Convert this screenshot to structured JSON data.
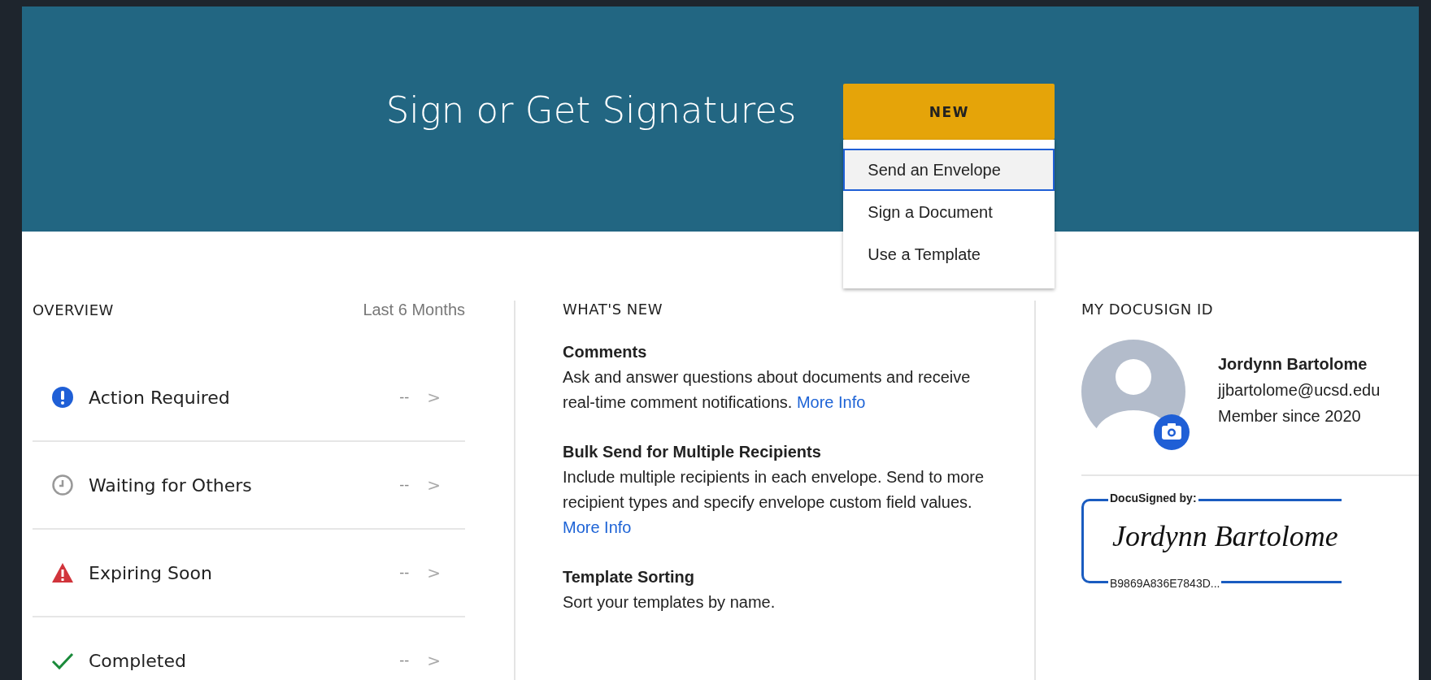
{
  "banner": {
    "title": "Sign or Get Signatures",
    "new_button": "NEW",
    "menu": [
      {
        "label": "Send an Envelope",
        "selected": true
      },
      {
        "label": "Sign a Document",
        "selected": false
      },
      {
        "label": "Use a Template",
        "selected": false
      }
    ]
  },
  "overview": {
    "title": "OVERVIEW",
    "period": "Last 6 Months",
    "rows": [
      {
        "kind": "action",
        "label": "Action Required",
        "count": "--",
        "arrow": ">"
      },
      {
        "kind": "waiting",
        "label": "Waiting for Others",
        "count": "--",
        "arrow": ">"
      },
      {
        "kind": "expiring",
        "label": "Expiring Soon",
        "count": "--",
        "arrow": ">"
      },
      {
        "kind": "completed",
        "label": "Completed",
        "count": "--",
        "arrow": ">"
      }
    ]
  },
  "whats_new": {
    "title": "WHAT'S NEW",
    "items": [
      {
        "title": "Comments",
        "text": "Ask and answer questions about documents and receive real-time comment notifications.",
        "link": "More Info"
      },
      {
        "title": "Bulk Send for Multiple Recipients",
        "text": "Include multiple recipients in each envelope. Send to more recipient types and specify envelope custom field values.",
        "link": "More Info"
      },
      {
        "title": "Template Sorting",
        "text": "Sort your templates by name."
      }
    ]
  },
  "docusign_id": {
    "title": "MY DOCUSIGN ID",
    "name": "Jordynn Bartolome",
    "email": "jjbartolome@ucsd.edu",
    "member_since": "Member since 2020",
    "signature": {
      "label": "DocuSigned by:",
      "signature": "Jordynn Bartolome",
      "code": "B9869A836E7843D..."
    }
  }
}
